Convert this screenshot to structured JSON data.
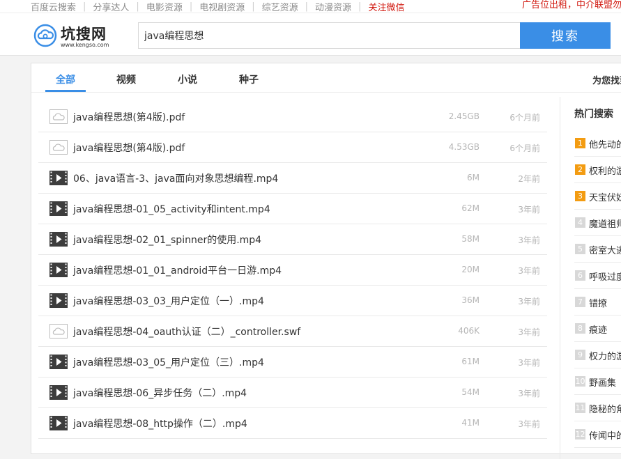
{
  "toplinks": [
    {
      "label": "百度云搜索",
      "highlight": false
    },
    {
      "label": "分享达人",
      "highlight": false
    },
    {
      "label": "电影资源",
      "highlight": false
    },
    {
      "label": "电视剧资源",
      "highlight": false
    },
    {
      "label": "综艺资源",
      "highlight": false
    },
    {
      "label": "动漫资源",
      "highlight": false
    },
    {
      "label": "关注微信",
      "highlight": true
    }
  ],
  "topright": "广告位出租，中介联盟勿扰",
  "logo": {
    "name": "坑搜网",
    "url": "www.kengso.com"
  },
  "search": {
    "value": "java编程思想",
    "button": "搜索"
  },
  "tabs": [
    {
      "label": "全部",
      "active": true
    },
    {
      "label": "视频",
      "active": false
    },
    {
      "label": "小说",
      "active": false
    },
    {
      "label": "种子",
      "active": false
    }
  ],
  "tab_right": "为您找到",
  "results": [
    {
      "name": "java编程思想(第4版).pdf",
      "size": "2.45GB",
      "time": "6个月前",
      "icon": "cloud-file-icon"
    },
    {
      "name": "java编程思想(第4版).pdf",
      "size": "4.53GB",
      "time": "6个月前",
      "icon": "cloud-file-icon"
    },
    {
      "name": "06、java语言-3、java面向对象思想编程.mp4",
      "size": "6M",
      "time": "2年前",
      "icon": "video-file-icon"
    },
    {
      "name": "java编程思想-01_05_activity和intent.mp4",
      "size": "62M",
      "time": "3年前",
      "icon": "video-file-icon"
    },
    {
      "name": "java编程思想-02_01_spinner的使用.mp4",
      "size": "58M",
      "time": "3年前",
      "icon": "video-file-icon"
    },
    {
      "name": "java编程思想-01_01_android平台一日游.mp4",
      "size": "20M",
      "time": "3年前",
      "icon": "video-file-icon"
    },
    {
      "name": "java编程思想-03_03_用户定位（一）.mp4",
      "size": "36M",
      "time": "3年前",
      "icon": "video-file-icon"
    },
    {
      "name": "java编程思想-04_oauth认证（二）_controller.swf",
      "size": "406K",
      "time": "3年前",
      "icon": "cloud-file-icon"
    },
    {
      "name": "java编程思想-03_05_用户定位（三）.mp4",
      "size": "61M",
      "time": "3年前",
      "icon": "video-file-icon"
    },
    {
      "name": "java编程思想-06_异步任务（二）.mp4",
      "size": "54M",
      "time": "3年前",
      "icon": "video-file-icon"
    },
    {
      "name": "java编程思想-08_http操作（二）.mp4",
      "size": "41M",
      "time": "3年前",
      "icon": "video-file-icon"
    }
  ],
  "hot": {
    "title": "热门搜索",
    "items": [
      {
        "num": "1",
        "text": "他先动的心"
      },
      {
        "num": "2",
        "text": "权利的游戏"
      },
      {
        "num": "3",
        "text": "天宝伏妖录"
      },
      {
        "num": "4",
        "text": "魔道祖师"
      },
      {
        "num": "5",
        "text": "密室大逃脱"
      },
      {
        "num": "6",
        "text": "呼吸过度"
      },
      {
        "num": "7",
        "text": "错撩"
      },
      {
        "num": "8",
        "text": "痕迹"
      },
      {
        "num": "9",
        "text": "权力的游戏"
      },
      {
        "num": "10",
        "text": "野画集"
      },
      {
        "num": "11",
        "text": "隐秘的角落"
      },
      {
        "num": "12",
        "text": "传闻中的陈芊芊"
      }
    ]
  },
  "colors": {
    "accent": "#3a8ee6",
    "red": "#d1170e",
    "badge_top": "#f39c12",
    "badge": "#d8d8d8"
  }
}
